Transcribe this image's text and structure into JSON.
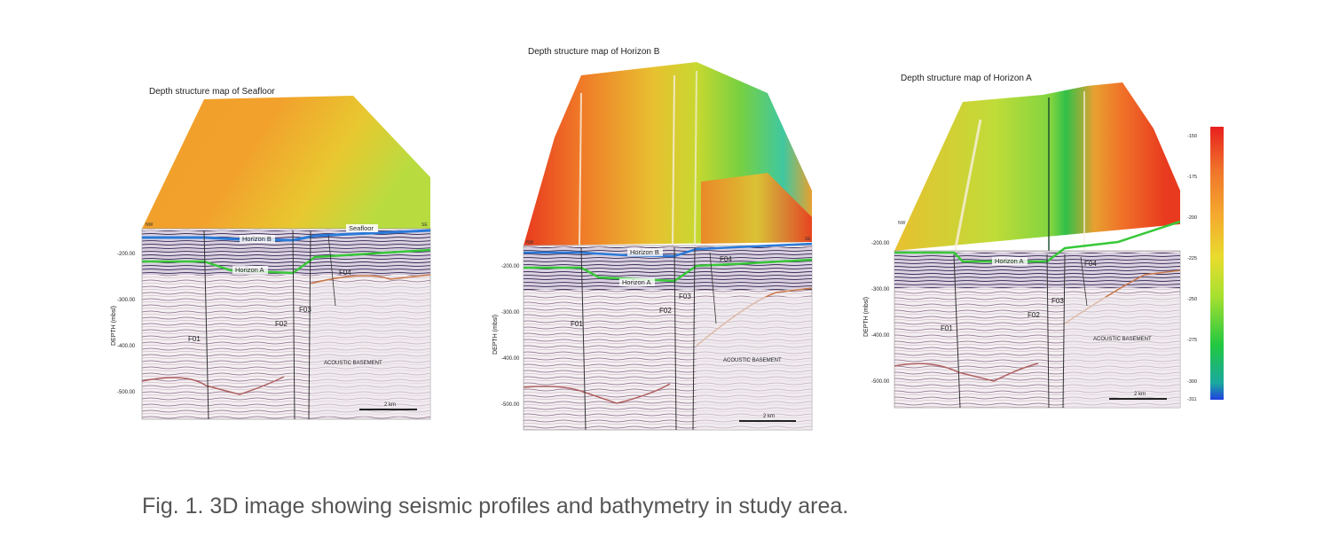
{
  "panels": [
    {
      "title": "Depth structure map of Seafloor",
      "corner_left": "NW",
      "corner_right": "SE",
      "ylabel": "DEPTH (mbsl)",
      "yticks": [
        "-200.00",
        "-300.00",
        "-400.00",
        "-500.00"
      ],
      "horizons": [
        "Horizon B",
        "Horizon A",
        "Seafloor"
      ],
      "faults": [
        "F01",
        "F02",
        "F03",
        "F04"
      ],
      "basement": "ACOUSTIC BASEMENT",
      "scale": "2 km"
    },
    {
      "title": "Depth structure map of Horizon B",
      "corner_left": "NW",
      "corner_right": "SE",
      "ylabel": "DEPTH (mbsl)",
      "yticks": [
        "-200.00",
        "-300.00",
        "-400.00",
        "-500.00"
      ],
      "horizons": [
        "Horizon B",
        "Horizon A"
      ],
      "faults": [
        "F01",
        "F02",
        "F03",
        "F04"
      ],
      "basement": "ACOUSTIC BASEMENT",
      "scale": "2 km"
    },
    {
      "title": "Depth structure map of Horizon A",
      "corner_left": "NW",
      "ylabel": "DEPTH (mbsl)",
      "yticks": [
        "-200.00",
        "-300.00",
        "-400.00",
        "-500.00"
      ],
      "horizons": [
        "Horizon A"
      ],
      "faults": [
        "F01",
        "F02",
        "F03",
        "F04"
      ],
      "basement": "ACOUSTIC BASEMENT",
      "scale": "2 km"
    }
  ],
  "colorbar": {
    "ticks": [
      "-150",
      "-175",
      "-200",
      "-225",
      "-250",
      "-275",
      "-300",
      "-311"
    ],
    "colors": [
      "#e8201e",
      "#f0742a",
      "#f5a82e",
      "#e8dc2e",
      "#a8e030",
      "#22c840",
      "#1aa8a0",
      "#2040e0"
    ]
  },
  "caption": "Fig. 1. 3D image showing seismic profiles and bathymetry in study area."
}
